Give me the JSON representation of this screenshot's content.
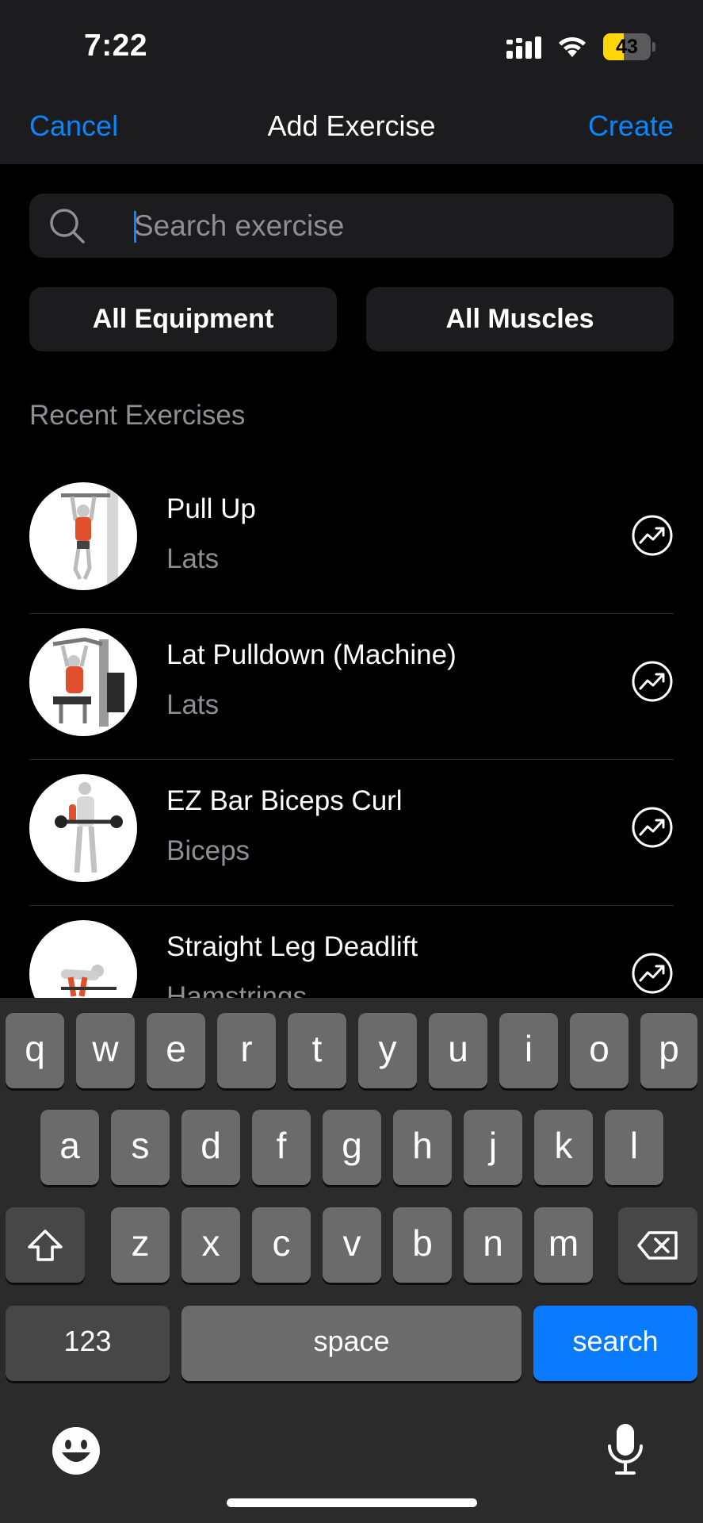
{
  "status_bar": {
    "time": "7:22",
    "battery": "43",
    "battery_level": 0.43
  },
  "nav": {
    "cancel": "Cancel",
    "title": "Add Exercise",
    "create": "Create"
  },
  "search": {
    "placeholder": "Search exercise"
  },
  "filters": {
    "equipment": "All Equipment",
    "muscles": "All Muscles"
  },
  "recent": {
    "title": "Recent Exercises",
    "items": [
      {
        "name": "Pull Up",
        "muscle": "Lats",
        "icon": "pull-up-icon"
      },
      {
        "name": "Lat Pulldown (Machine)",
        "muscle": "Lats",
        "icon": "lat-pulldown-icon"
      },
      {
        "name": "EZ Bar Biceps Curl",
        "muscle": "Biceps",
        "icon": "biceps-curl-icon"
      },
      {
        "name": "Straight Leg Deadlift",
        "muscle": "Hamstrings",
        "icon": "deadlift-icon"
      }
    ]
  },
  "keyboard": {
    "row1": [
      "q",
      "w",
      "e",
      "r",
      "t",
      "y",
      "u",
      "i",
      "o",
      "p"
    ],
    "row2": [
      "a",
      "s",
      "d",
      "f",
      "g",
      "h",
      "j",
      "k",
      "l"
    ],
    "row3": [
      "z",
      "x",
      "c",
      "v",
      "b",
      "n",
      "m"
    ],
    "numbers": "123",
    "space": "space",
    "search": "search"
  },
  "colors": {
    "accent": "#0a84ff",
    "secondary_text": "#8e8e93",
    "battery": "#ffd60a"
  }
}
